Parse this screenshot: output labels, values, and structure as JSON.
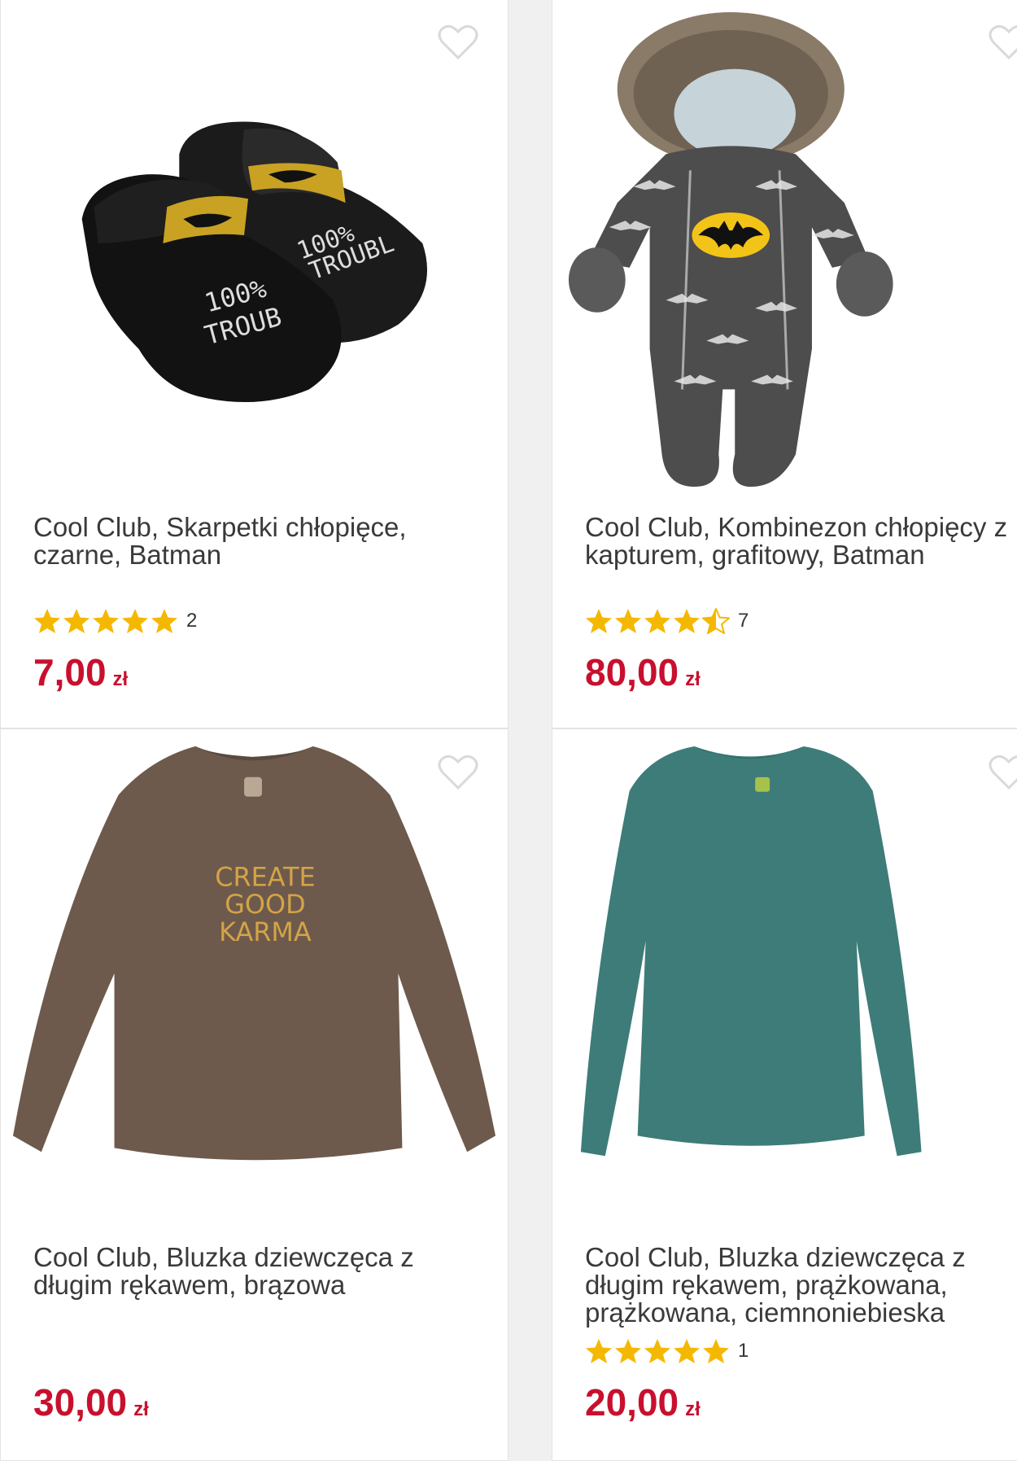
{
  "products": [
    {
      "title_lines": [
        "Cool Club, Skarpetki chłopięce,",
        "czarne, Batman"
      ],
      "rating": 5,
      "rating_count": "2",
      "price": "7,00",
      "currency": "zł"
    },
    {
      "title_lines": [
        "Cool Club, Kombinezon chłopięcy z",
        "kapturem, grafitowy, Batman"
      ],
      "rating": 4.5,
      "rating_count": "7",
      "price": "80,00",
      "currency": "zł"
    },
    {
      "title_lines": [
        "Cool Club, Bluzka dziewczęca z",
        "długim rękawem, brązowa"
      ],
      "price": "30,00",
      "currency": "zł"
    },
    {
      "title_lines": [
        "Cool Club, Bluzka dziewczęca z",
        "długim rękawem, prążkowana,",
        "prążkowana, ciemnoniebieska"
      ],
      "rating": 5,
      "rating_count": "1",
      "price": "20,00",
      "currency": "zł"
    }
  ],
  "sweater_print": [
    "CREATE",
    "GOOD",
    "KARMA"
  ],
  "colors": {
    "price": "#c8102e",
    "star": "#f5b800",
    "title": "#3a3a3a"
  }
}
